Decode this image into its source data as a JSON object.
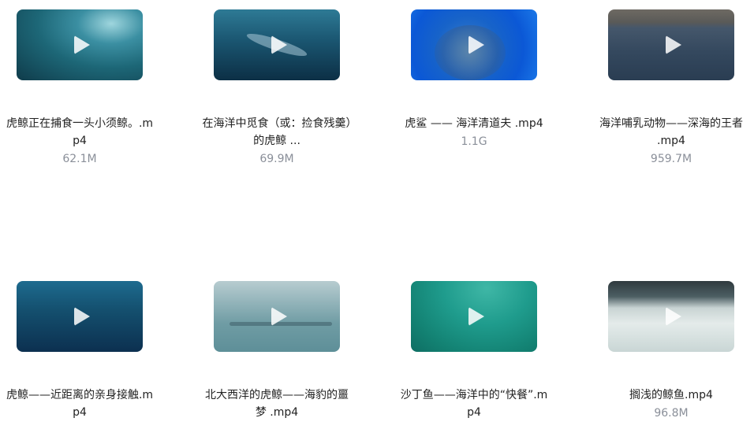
{
  "files": [
    {
      "title": "虎鲸正在捕食一头小须鲸。.mp4",
      "size": "62.1M"
    },
    {
      "title": "在海洋中觅食（或：捡食残羹）的虎鲸 ...",
      "size": "69.9M"
    },
    {
      "title": "虎鲨 —— 海洋清道夫 .mp4",
      "size": "1.1G"
    },
    {
      "title": "海洋哺乳动物——深海的王者 .mp4",
      "size": "959.7M"
    },
    {
      "title": "虎鲸——近距离的亲身接触.mp4",
      "size": ""
    },
    {
      "title": "北大西洋的虎鲸——海豹的噩梦 .mp4",
      "size": ""
    },
    {
      "title": "沙丁鱼——海洋中的“快餐”.mp4",
      "size": ""
    },
    {
      "title": "搁浅的鲸鱼.mp4",
      "size": "96.8M"
    }
  ],
  "icons": {
    "thumbnail_overlay": "play-icon"
  }
}
